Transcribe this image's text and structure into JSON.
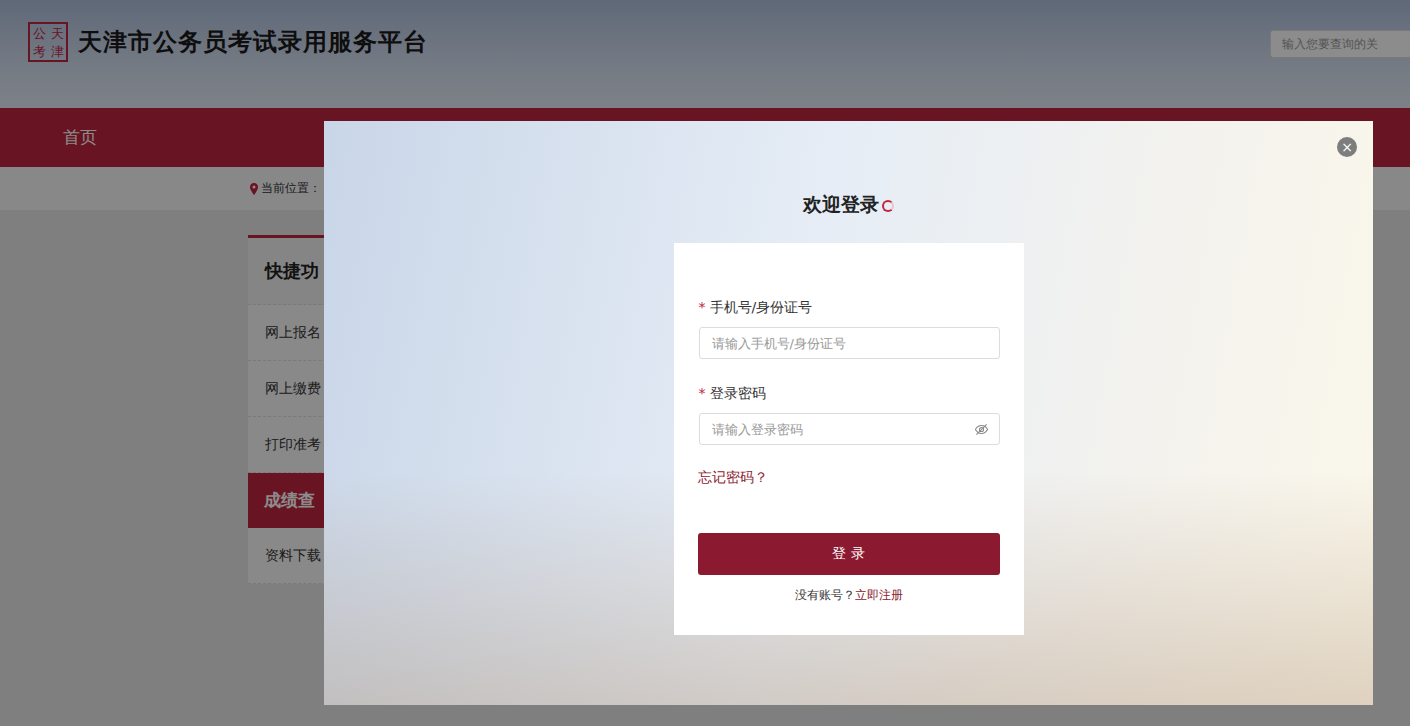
{
  "header": {
    "seal": [
      "公",
      "天",
      "考",
      "津"
    ],
    "title": "天津市公务员考试录用服务平台",
    "search": {
      "placeholder": "输入您要查询的关"
    }
  },
  "nav": [
    {
      "label": "首页"
    }
  ],
  "breadcrumb": "当前位置：",
  "sidebar": {
    "title": "快捷功",
    "items": [
      {
        "label": "网上报名",
        "kind": "link"
      },
      {
        "label": "网上缴费",
        "kind": "link"
      },
      {
        "label": "打印准考",
        "kind": "link"
      },
      {
        "label": "成绩查",
        "kind": "section"
      },
      {
        "label": "资料下载",
        "kind": "link"
      }
    ]
  },
  "dialog": {
    "title": "欢迎登录",
    "close": "×",
    "fields": [
      {
        "required_mark": "*",
        "label": "手机号/身份证号",
        "placeholder": "请输入手机号/身份证号",
        "kind": "text"
      },
      {
        "required_mark": "*",
        "label": "登录密码",
        "placeholder": "请输入登录密码",
        "kind": "password"
      }
    ],
    "forgot": "忘记密码？",
    "submit": "登 录",
    "register_prompt": "没有账号？",
    "register_link": "立即注册"
  }
}
